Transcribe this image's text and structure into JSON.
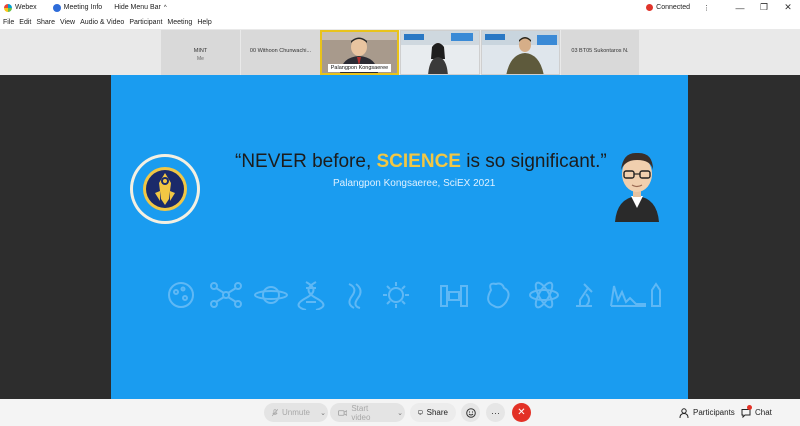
{
  "titlebar": {
    "app_name": "Webex",
    "meeting_info": "Meeting Info",
    "hide_menu": "Hide Menu Bar",
    "chevron": "^",
    "status": "Connected",
    "status_color": "#e0342b",
    "more": "⋮",
    "minimize": "—",
    "maximize": "❐",
    "close": "✕"
  },
  "menu": {
    "items": [
      {
        "label": "File"
      },
      {
        "label": "Edit"
      },
      {
        "label": "Share"
      },
      {
        "label": "View"
      },
      {
        "label": "Audio & Video"
      },
      {
        "label": "Participant"
      },
      {
        "label": "Meeting"
      },
      {
        "label": "Help"
      }
    ]
  },
  "participants_strip": {
    "tiles": [
      {
        "name": "MINT",
        "sub": "Me"
      },
      {
        "name": "00 Withoon Chunwachi..."
      },
      {
        "name": "Palangpon Kongsaeree"
      },
      {
        "name": "03 BT05 Sukontaros N."
      }
    ]
  },
  "slide": {
    "quote_open": "“NEVER before, ",
    "quote_highlight": "SCIENCE",
    "quote_close": " is  so significant.”",
    "attribution": "Palangpon Kongsaeree, SciEX 2021",
    "highlight_color": "#f2c744",
    "background_color": "#1a9cf0"
  },
  "controls": {
    "unmute": "Unmute",
    "start_video": "Start video",
    "share": "Share",
    "participants": "Participants",
    "chat": "Chat",
    "more": "···",
    "end_color": "#e33126"
  }
}
